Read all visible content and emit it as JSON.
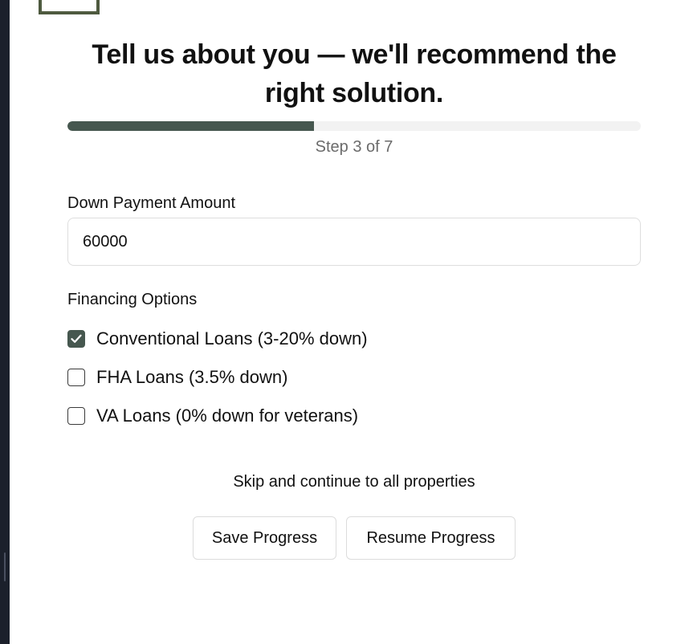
{
  "form": {
    "title": "Tell us about you — we'll recommend the right solution.",
    "progress": {
      "current_step": 3,
      "total_steps": 7,
      "fraction": 0.43,
      "label": "Step 3 of 7"
    },
    "down_payment": {
      "label": "Down Payment Amount",
      "value": "60000"
    },
    "financing": {
      "label": "Financing Options",
      "options": [
        {
          "label": "Conventional Loans (3-20% down)",
          "checked": true
        },
        {
          "label": "FHA Loans (3.5% down)",
          "checked": false
        },
        {
          "label": "VA Loans (0% down for veterans)",
          "checked": false
        }
      ]
    },
    "skip_label": "Skip and continue to all properties",
    "save_label": "Save Progress",
    "resume_label": "Resume Progress"
  },
  "colors": {
    "accent": "#46574f",
    "logo": "#4e5a3f",
    "muted_text": "#6b6b6b"
  },
  "icons": {
    "logo": "logo-icon",
    "check": "checkmark-icon"
  }
}
